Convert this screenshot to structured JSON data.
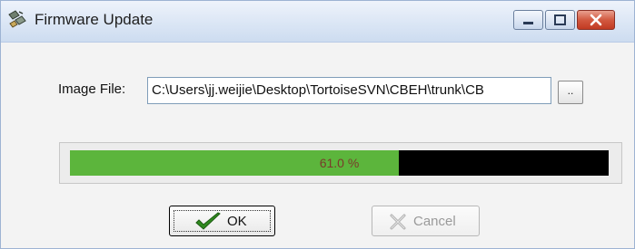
{
  "window": {
    "title": "Firmware Update",
    "icon": "firmware-chip-icon",
    "controls": [
      "minimize-icon",
      "maximize-icon",
      "close-icon"
    ]
  },
  "form": {
    "image_label": "Image File:",
    "image_path": "C:\\Users\\jj.weijie\\Desktop\\TortoiseSVN\\CBEH\\trunk\\CB",
    "browse_label": ".."
  },
  "progress": {
    "percent": 61.0,
    "label": "61.0 %",
    "fill_color": "#5cb53c",
    "track_color": "#000000"
  },
  "buttons": {
    "ok_label": "OK",
    "ok_icon": "checkmark-icon",
    "cancel_label": "Cancel",
    "cancel_icon": "cancel-x-icon",
    "cancel_enabled": false
  }
}
